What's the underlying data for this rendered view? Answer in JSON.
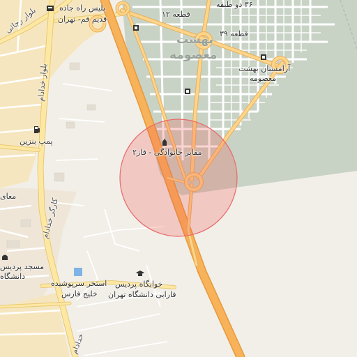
{
  "map": {
    "colors": {
      "background": "#f2efe9",
      "residential": "#f6e6bf",
      "cemetery": "#c8d3c6",
      "cemetery_grid": "#ffffff",
      "major_road": "#f7b25a",
      "major_road_casing": "#e59a3d",
      "street_light": "#fde8a3",
      "minor_road": "#ffffff",
      "circle_fill": "rgba(239,83,80,0.25)",
      "circle_stroke": "#e86a6a"
    },
    "labels": {
      "police": "پلیس راه جاده",
      "police2": "قدیم قم- تهران",
      "qeta12": "قطعه ۱۲",
      "doTabaqe": "۳۶ دو طبقه",
      "qeta39": "قطعه ۳۹",
      "behesht1": "بهشت",
      "behesht2": "معصومه",
      "aramestan1": "آرامستان بهشت",
      "aramestan2": "معصومه",
      "maqaber": "مقابر خانوادگی - فاز۲",
      "pomp": "پمپ بنزین",
      "bolvarRaja": "بلوار رجائی",
      "bolvarKhodadam": "بلوار خدادام",
      "kargarKhodadam": "کارگر خدادام",
      "estakhr1": "استخر سرپوشیده",
      "estakhr2": "خلیج فارس",
      "khabgah1": "خوابگاه پردیس",
      "khabgah2": "فارابی دانشگاه تهران",
      "masjed": "مسجد پردیس",
      "daneshgah": "دانشگاه",
      "khodadamBottom": "خدادام",
      "maa": "معای"
    },
    "icons": [
      "police-icon",
      "fuel-icon",
      "cemetery-icon",
      "grave-icon",
      "university-icon",
      "pool-icon",
      "mosque-icon"
    ]
  }
}
